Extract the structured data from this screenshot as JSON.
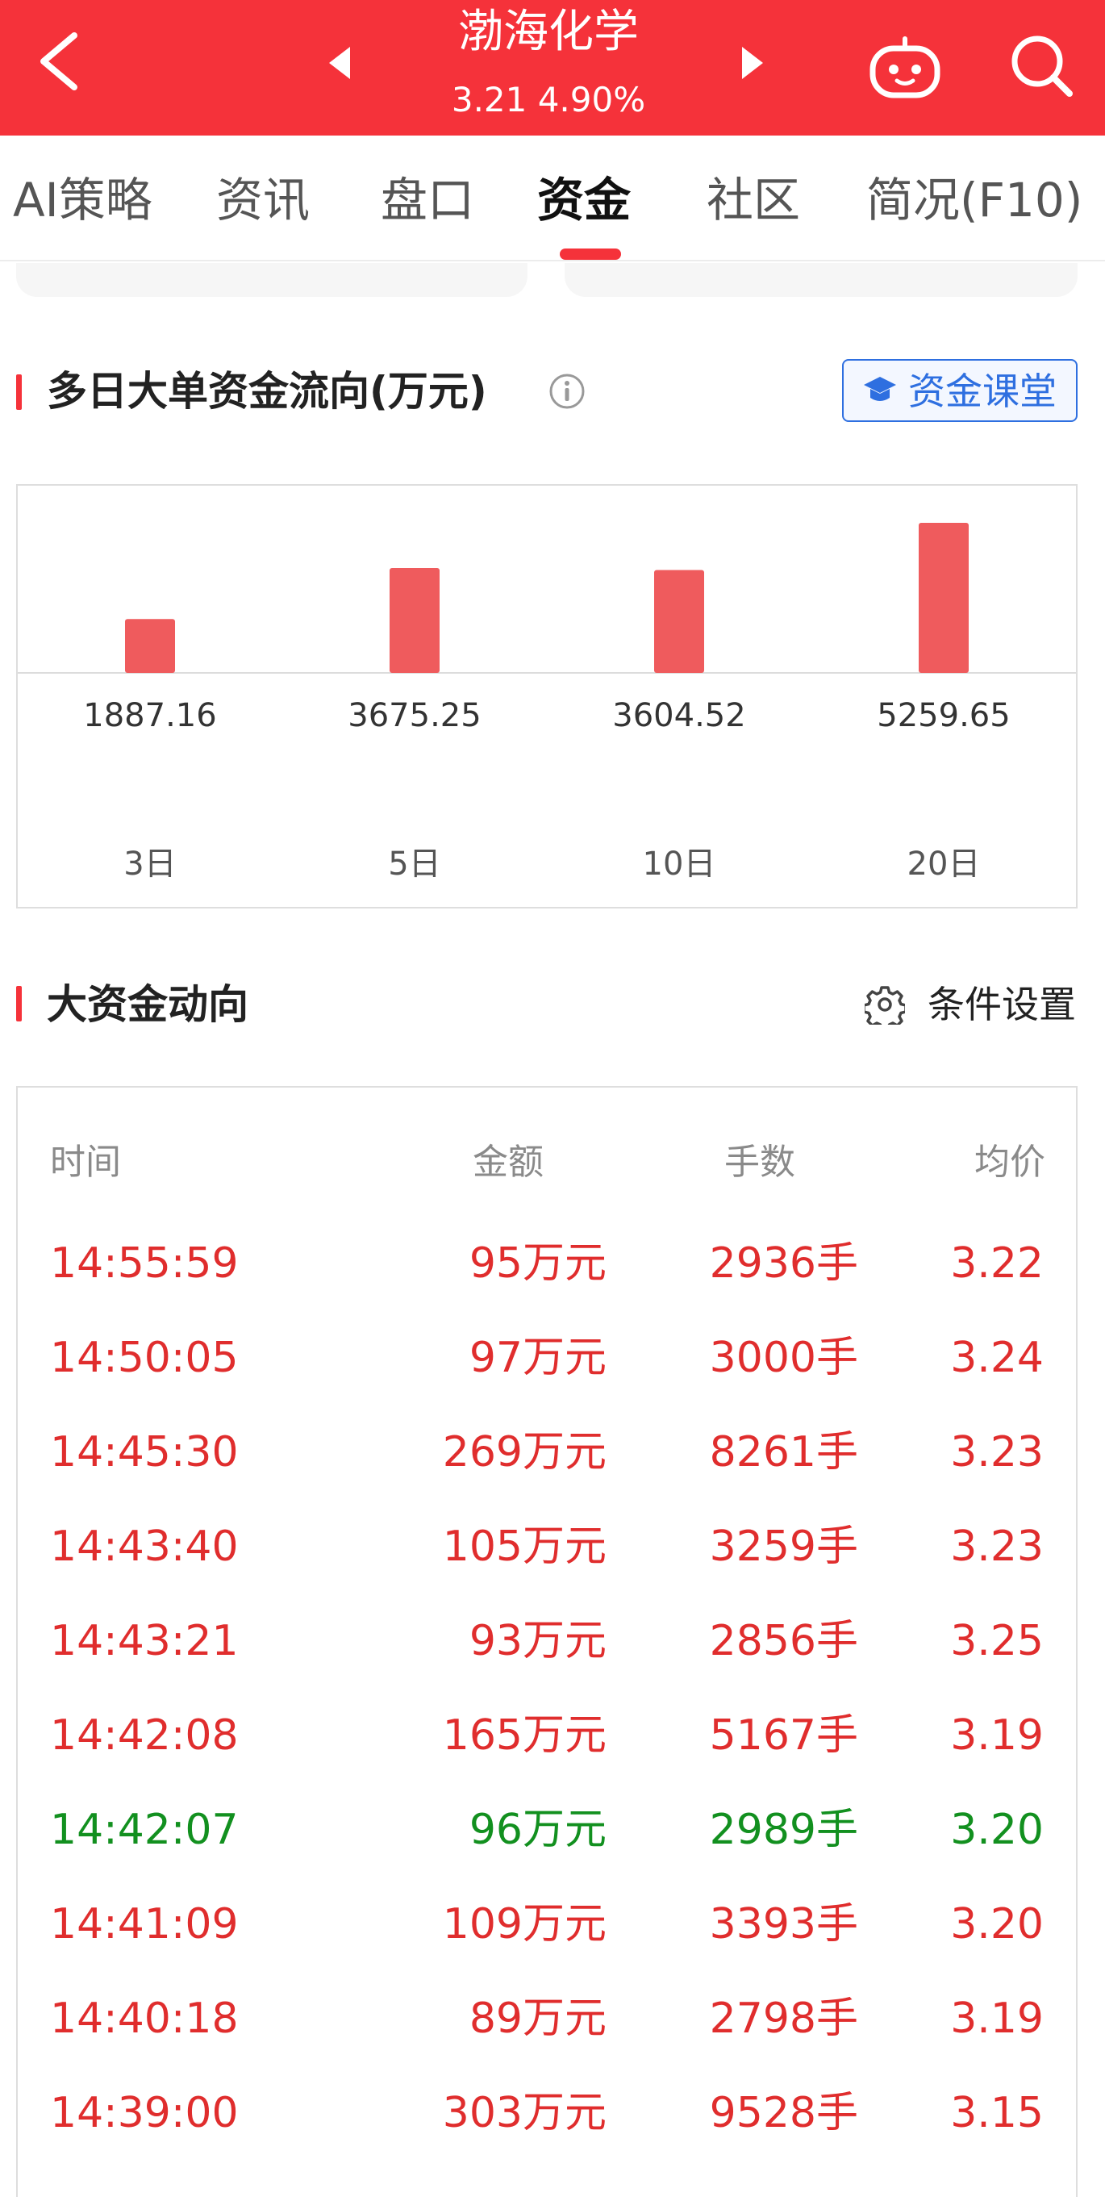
{
  "header": {
    "title": "渤海化学",
    "subtitle": "3.21 4.90%",
    "bg_color": "#f5323a",
    "icons": [
      "back-arrow-icon",
      "prev-stock-icon",
      "next-stock-icon",
      "robot-assistant-icon",
      "search-icon"
    ]
  },
  "tabs": [
    {
      "label": "AI策略"
    },
    {
      "label": "资讯"
    },
    {
      "label": "盘口"
    },
    {
      "label": "资金"
    },
    {
      "label": "社区"
    },
    {
      "label": "简况(F10)"
    }
  ],
  "active_tab": "资金",
  "flow_section": {
    "title": "多日大单资金流向(万元)",
    "course_button": "资金课堂"
  },
  "chart_data": {
    "type": "bar",
    "categories": [
      "3日",
      "5日",
      "10日",
      "20日"
    ],
    "values": [
      1887.16,
      3675.25,
      3604.52,
      5259.65
    ],
    "value_labels": [
      "1887.16",
      "3675.25",
      "3604.52",
      "5259.65"
    ],
    "bar_color": "#ef5b5d"
  },
  "big_money_section": {
    "title": "大资金动向",
    "settings_label": "条件设置"
  },
  "table": {
    "columns": [
      "时间",
      "金额",
      "手数",
      "均价"
    ],
    "rows": [
      {
        "time": "14:55:59",
        "amount": "95万元",
        "volume": "2936手",
        "price": "3.22",
        "dir": "up"
      },
      {
        "time": "14:50:05",
        "amount": "97万元",
        "volume": "3000手",
        "price": "3.24",
        "dir": "up"
      },
      {
        "time": "14:45:30",
        "amount": "269万元",
        "volume": "8261手",
        "price": "3.23",
        "dir": "up"
      },
      {
        "time": "14:43:40",
        "amount": "105万元",
        "volume": "3259手",
        "price": "3.23",
        "dir": "up"
      },
      {
        "time": "14:43:21",
        "amount": "93万元",
        "volume": "2856手",
        "price": "3.25",
        "dir": "up"
      },
      {
        "time": "14:42:08",
        "amount": "165万元",
        "volume": "5167手",
        "price": "3.19",
        "dir": "up"
      },
      {
        "time": "14:42:07",
        "amount": "96万元",
        "volume": "2989手",
        "price": "3.20",
        "dir": "down"
      },
      {
        "time": "14:41:09",
        "amount": "109万元",
        "volume": "3393手",
        "price": "3.20",
        "dir": "up"
      },
      {
        "time": "14:40:18",
        "amount": "89万元",
        "volume": "2798手",
        "price": "3.19",
        "dir": "up"
      },
      {
        "time": "14:39:00",
        "amount": "303万元",
        "volume": "9528手",
        "price": "3.15",
        "dir": "up"
      }
    ],
    "up_color": "#e02d2d",
    "down_color": "#12901f"
  }
}
